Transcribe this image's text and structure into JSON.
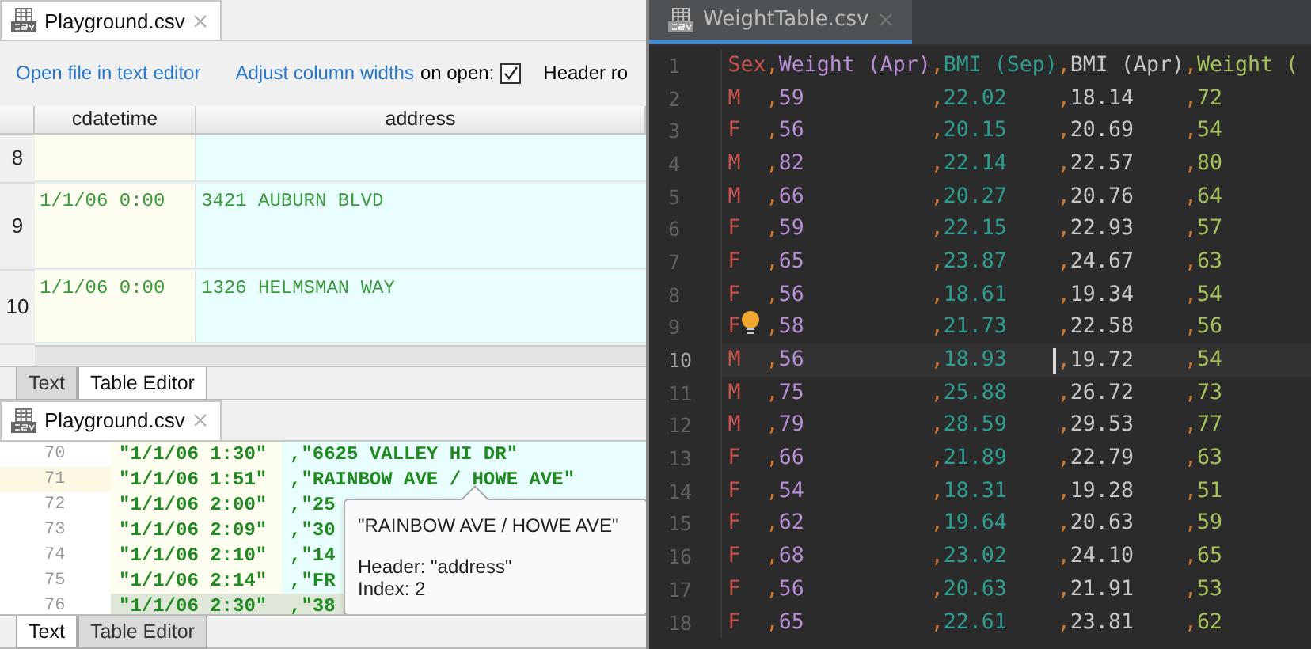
{
  "table_editor": {
    "file_tab": "Playground.csv",
    "toolbar": {
      "open_link": "Open file in text editor",
      "adjust_link": "Adjust column widths",
      "on_open_label": "on open:",
      "adjust_checked": true,
      "header_label": "Header ro"
    },
    "columns": [
      "cdatetime",
      "address"
    ],
    "rows": [
      {
        "number": "8"
      },
      {
        "number": "9",
        "cells": [
          "1/1/06 0:00",
          "3421 AUBURN BLVD"
        ]
      },
      {
        "number": "10",
        "cells": [
          "1/1/06 0:00",
          "1326 HELMSMAN WAY"
        ]
      }
    ],
    "view_tabs": [
      {
        "label": "Text",
        "selected": false
      },
      {
        "label": "Table Editor",
        "selected": true
      }
    ]
  },
  "text_editor": {
    "file_tab": "Playground.csv",
    "separator": ",",
    "lines": [
      {
        "number": "70",
        "cells": [
          "\"1/1/06 1:30\"",
          "\"6625 VALLEY HI DR\""
        ],
        "current": false,
        "selected": false
      },
      {
        "number": "71",
        "cells": [
          "\"1/1/06 1:51\"",
          "\"RAINBOW AVE / HOWE AVE\""
        ],
        "current": true,
        "selected": false
      },
      {
        "number": "72",
        "cells": [
          "\"1/1/06 2:00\"",
          "\"25"
        ],
        "current": false,
        "selected": false
      },
      {
        "number": "73",
        "cells": [
          "\"1/1/06 2:09\"",
          "\"30"
        ],
        "current": false,
        "selected": false
      },
      {
        "number": "74",
        "cells": [
          "\"1/1/06 2:10\"",
          "\"14"
        ],
        "current": false,
        "selected": false
      },
      {
        "number": "75",
        "cells": [
          "\"1/1/06 2:14\"",
          "\"FR"
        ],
        "current": false,
        "selected": false
      },
      {
        "number": "76",
        "cells": [
          "\"1/1/06 2:30\"",
          "\"38"
        ],
        "current": false,
        "selected": true
      }
    ],
    "tooltip": {
      "value": "\"RAINBOW AVE / HOWE AVE\"",
      "header": "Header: \"address\"",
      "index": "Index: 2"
    },
    "view_tabs": [
      {
        "label": "Text",
        "selected": true
      },
      {
        "label": "Table Editor",
        "selected": false
      }
    ]
  },
  "weight_table": {
    "file_tab": "WeightTable.csv",
    "separator": ",",
    "columns": [
      {
        "color": "#c9524e"
      },
      {
        "color": "#b98fd6"
      },
      {
        "color": "#2f9e8f"
      },
      {
        "color": "#c8c8c8"
      },
      {
        "color": "#a4c15a"
      }
    ],
    "lines": [
      {
        "number": "1",
        "cells": [
          "Sex",
          "Weight (Apr)",
          "BMI (Sep)",
          "BMI (Apr)",
          "Weight ("
        ],
        "current": false,
        "hint": false
      },
      {
        "number": "2",
        "cells": [
          "M",
          "59",
          "22.02",
          "18.14",
          "72"
        ],
        "current": false,
        "hint": false
      },
      {
        "number": "3",
        "cells": [
          "F",
          "56",
          "20.15",
          "20.69",
          "54"
        ],
        "current": false,
        "hint": false
      },
      {
        "number": "4",
        "cells": [
          "M",
          "82",
          "22.14",
          "22.57",
          "80"
        ],
        "current": false,
        "hint": false
      },
      {
        "number": "5",
        "cells": [
          "M",
          "66",
          "20.27",
          "20.76",
          "64"
        ],
        "current": false,
        "hint": false
      },
      {
        "number": "6",
        "cells": [
          "F",
          "59",
          "22.15",
          "22.93",
          "57"
        ],
        "current": false,
        "hint": false
      },
      {
        "number": "7",
        "cells": [
          "F",
          "65",
          "23.87",
          "24.67",
          "63"
        ],
        "current": false,
        "hint": false
      },
      {
        "number": "8",
        "cells": [
          "F",
          "56",
          "18.61",
          "19.34",
          "54"
        ],
        "current": false,
        "hint": false
      },
      {
        "number": "9",
        "cells": [
          "F",
          "58",
          "21.73",
          "22.58",
          "56"
        ],
        "current": false,
        "hint": true
      },
      {
        "number": "10",
        "cells": [
          "M",
          "56",
          "18.93",
          "19.72",
          "54"
        ],
        "current": true,
        "hint": false
      },
      {
        "number": "11",
        "cells": [
          "M",
          "75",
          "25.88",
          "26.72",
          "73"
        ],
        "current": false,
        "hint": false
      },
      {
        "number": "12",
        "cells": [
          "M",
          "79",
          "28.59",
          "29.53",
          "77"
        ],
        "current": false,
        "hint": false
      },
      {
        "number": "13",
        "cells": [
          "F",
          "66",
          "21.89",
          "22.79",
          "63"
        ],
        "current": false,
        "hint": false
      },
      {
        "number": "14",
        "cells": [
          "F",
          "54",
          "18.31",
          "19.28",
          "51"
        ],
        "current": false,
        "hint": false
      },
      {
        "number": "15",
        "cells": [
          "F",
          "62",
          "19.64",
          "20.63",
          "59"
        ],
        "current": false,
        "hint": false
      },
      {
        "number": "16",
        "cells": [
          "F",
          "68",
          "23.02",
          "24.10",
          "65"
        ],
        "current": false,
        "hint": false
      },
      {
        "number": "17",
        "cells": [
          "F",
          "56",
          "20.63",
          "21.91",
          "53"
        ],
        "current": false,
        "hint": false
      },
      {
        "number": "18",
        "cells": [
          "F",
          "65",
          "22.61",
          "23.81",
          "62"
        ],
        "current": false,
        "hint": false
      }
    ]
  }
}
